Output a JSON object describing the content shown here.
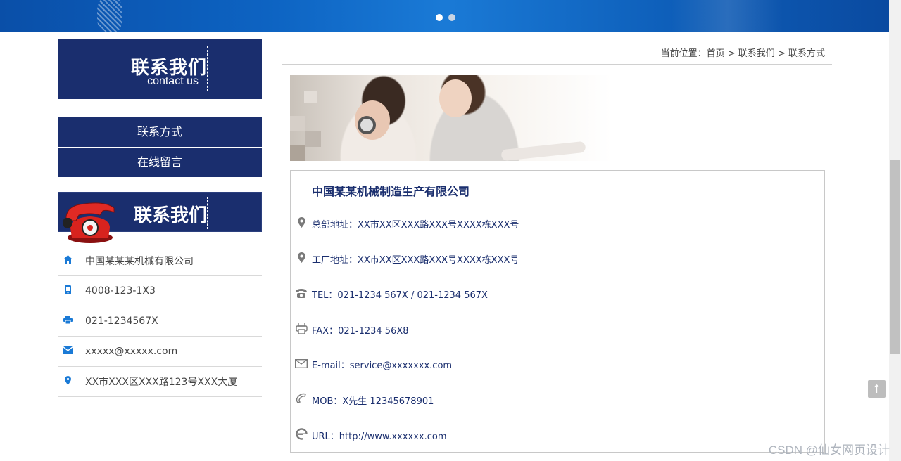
{
  "banner": {
    "dots": [
      "slide-1",
      "slide-2"
    ]
  },
  "sidebar": {
    "contact_title": "联系我们",
    "contact_sub": "contact us",
    "menu": [
      {
        "label": "联系方式"
      },
      {
        "label": "在线留言"
      }
    ],
    "phone_title": "联系我们",
    "info": [
      {
        "icon": "home-icon",
        "text": "中国某某某机械有限公司"
      },
      {
        "icon": "mobile-icon",
        "text": "4008-123-1X3"
      },
      {
        "icon": "printer-icon",
        "text": "021-1234567X"
      },
      {
        "icon": "mail-icon",
        "text": "xxxxx@xxxxx.com"
      },
      {
        "icon": "location-icon",
        "text": "XX市XXX区XXX路123号XXX大厦"
      }
    ]
  },
  "breadcrumb": {
    "prefix": "当前位置：",
    "items": [
      "首页",
      "联系我们",
      "联系方式"
    ],
    "sep": ">"
  },
  "main": {
    "company": "中国某某机械制造生产有限公司",
    "rows": [
      {
        "icon": "location-icon",
        "text": "总部地址：XX市XX区XXX路XXX号XXXX栋XXX号"
      },
      {
        "icon": "location-icon",
        "text": "工厂地址：XX市XX区XXX路XXX号XXXX栋XXX号"
      },
      {
        "icon": "telephone-icon",
        "text": "TEL：021-1234 567X / 021-1234 567X"
      },
      {
        "icon": "fax-icon",
        "text": "FAX：021-1234 56X8"
      },
      {
        "icon": "mail-icon",
        "text": "E-mail：service@xxxxxxx.com"
      },
      {
        "icon": "phone-handset-icon",
        "text": "MOB：X先生 12345678901"
      },
      {
        "icon": "browser-icon",
        "text": "URL：http://www.xxxxxx.com"
      }
    ]
  },
  "totop_label": "↑",
  "watermark": "CSDN @仙女网页设计"
}
